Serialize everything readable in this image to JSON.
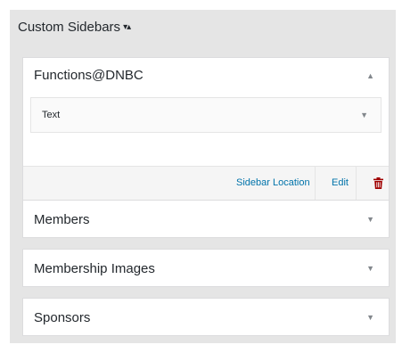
{
  "panel": {
    "title": "Custom Sidebars",
    "toggle": "▾▴"
  },
  "areas": [
    {
      "title": "Functions@DNBC",
      "arrow": "▲",
      "expanded": true,
      "widgets": [
        {
          "title": "Text",
          "arrow": "▼"
        }
      ],
      "footer": {
        "location_label": "Sidebar Location",
        "edit_label": "Edit",
        "delete_icon": "trash-icon"
      }
    },
    {
      "title": "Members",
      "arrow": "▼",
      "expanded": false
    },
    {
      "title": "Membership Images",
      "arrow": "▼",
      "expanded": false
    },
    {
      "title": "Sponsors",
      "arrow": "▼",
      "expanded": false
    }
  ],
  "colors": {
    "panel_bg": "#e5e5e5",
    "link": "#0073aa",
    "delete": "#a00000"
  }
}
